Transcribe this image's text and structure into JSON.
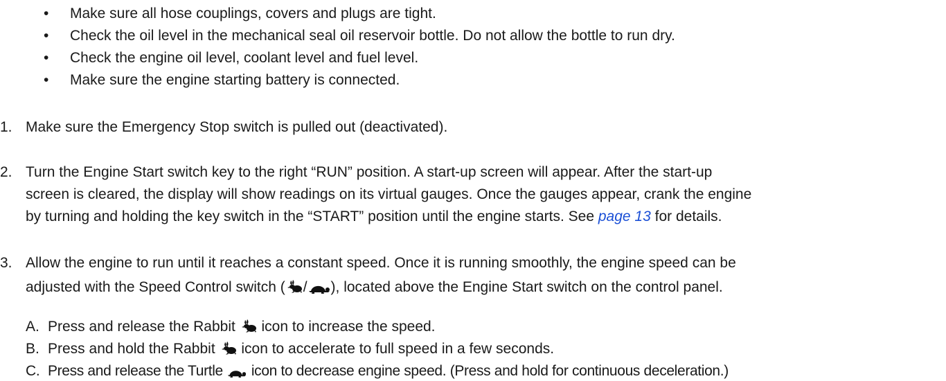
{
  "bullets": [
    "Make sure all hose couplings, covers and plugs are tight.",
    "Check the oil level in the mechanical seal oil reservoir bottle. Do not allow the bottle to run dry.",
    "Check the engine oil level, coolant level and fuel level.",
    "Make sure the engine starting battery is connected."
  ],
  "bullet_glyph": "•",
  "steps": {
    "s1": {
      "num": "1.",
      "text": "Make sure the Emergency Stop switch is pulled out (deactivated)."
    },
    "s2": {
      "num": "2.",
      "line1": "Turn the Engine Start switch key to the right “RUN” position. A start-up screen will appear. After the start-up",
      "line2": "screen is cleared, the display will show readings on its virtual gauges. Once the gauges appear, crank the engine",
      "line3_pre": "by turning and holding the key switch in the “START” position until the engine starts. See ",
      "line3_link": "page 13",
      "line3_post": " for details."
    },
    "s3": {
      "num": "3.",
      "line1": "Allow the engine to run until it reaches a constant speed. Once it is running smoothly, the engine speed can be",
      "line2_pre": "adjusted with the Speed Control switch (",
      "line2_sep": "/",
      "line2_post": "), located above the Engine Start switch on the control panel."
    }
  },
  "substeps": {
    "a": {
      "letter": "A.",
      "pre": "Press and release the Rabbit",
      "post": "icon to increase the speed."
    },
    "b": {
      "letter": "B.",
      "pre": "Press and hold the Rabbit",
      "post": "icon to accelerate to full speed in a few seconds."
    },
    "c": {
      "letter": "C.",
      "pre": "Press and release the Turtle",
      "post": "icon to decrease engine speed. (Press and hold for continuous deceleration.)"
    }
  },
  "icons": {
    "rabbit": "rabbit-icon",
    "turtle": "turtle-icon"
  },
  "colors": {
    "text": "#1a1a1a",
    "link": "#1a4fd6"
  }
}
